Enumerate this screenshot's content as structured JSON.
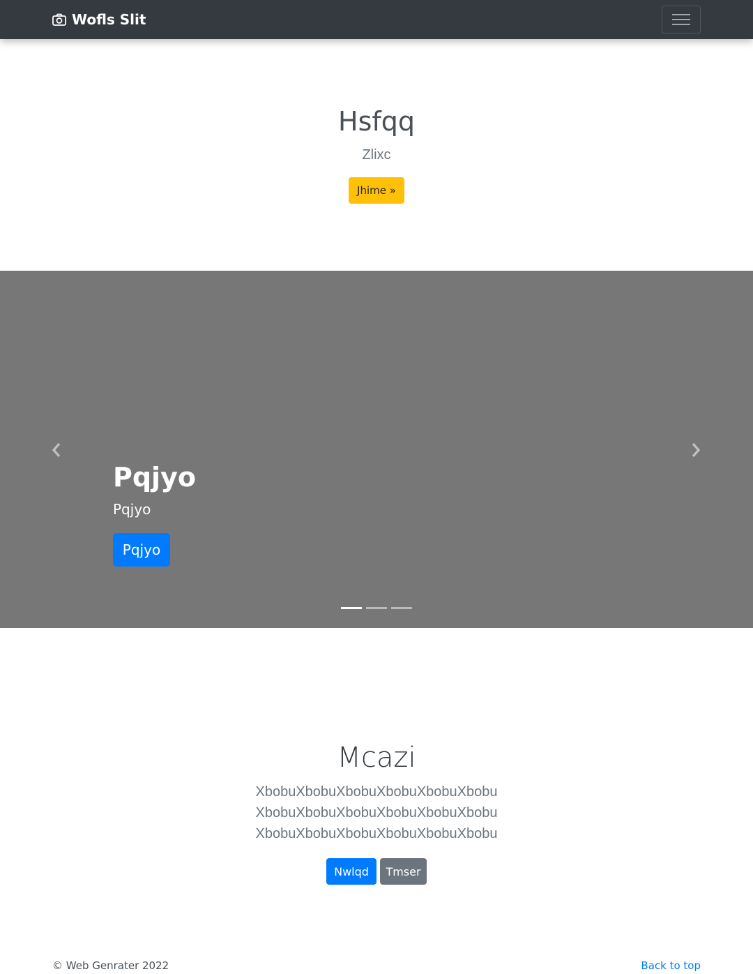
{
  "navbar": {
    "brand": "Wofls Slit",
    "brand_icon": "camera-icon",
    "toggler_icon": "hamburger-menu-icon"
  },
  "hero": {
    "title": "Hsfqq",
    "subtitle": "Zlixc",
    "button_label": "Jhime »"
  },
  "carousel": {
    "caption_title": "Pqjyo",
    "caption_text": "Pqjyo",
    "button_label": "Pqjyo",
    "slide_count": 3,
    "active_slide": 1,
    "background_color": "#777777"
  },
  "section": {
    "title": "Mcazi",
    "lines": [
      "XbobuXbobuXbobuXbobuXbobuXbobu",
      "XbobuXbobuXbobuXbobuXbobuXbobu",
      "XbobuXbobuXbobuXbobuXbobuXbobu"
    ],
    "primary_button": "Nwlqd",
    "secondary_button": "Tmser"
  },
  "footer": {
    "copyright": "© Web Genrater 2022",
    "back_to_top": "Back to top"
  },
  "colors": {
    "navbar_bg": "#343a40",
    "primary": "#007bff",
    "warning": "#ffc107",
    "secondary": "#6c757d"
  }
}
